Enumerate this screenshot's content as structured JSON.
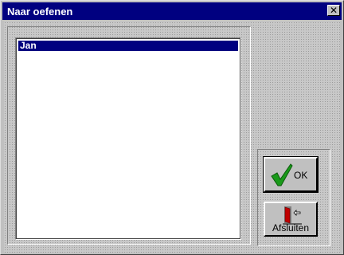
{
  "window": {
    "title": "Naar oefenen",
    "close_glyph": "✕"
  },
  "list": {
    "items": [
      {
        "label": "Jan",
        "selected": true
      }
    ]
  },
  "buttons": {
    "ok_label": "OK",
    "ok_icon": "checkmark-icon",
    "close_label": "Afsluiten",
    "close_icon": "exit-door-icon"
  },
  "colors": {
    "titlebar": "#000080",
    "selection": "#000080",
    "checkmark": "#1a9a1a",
    "door": "#c00000"
  }
}
